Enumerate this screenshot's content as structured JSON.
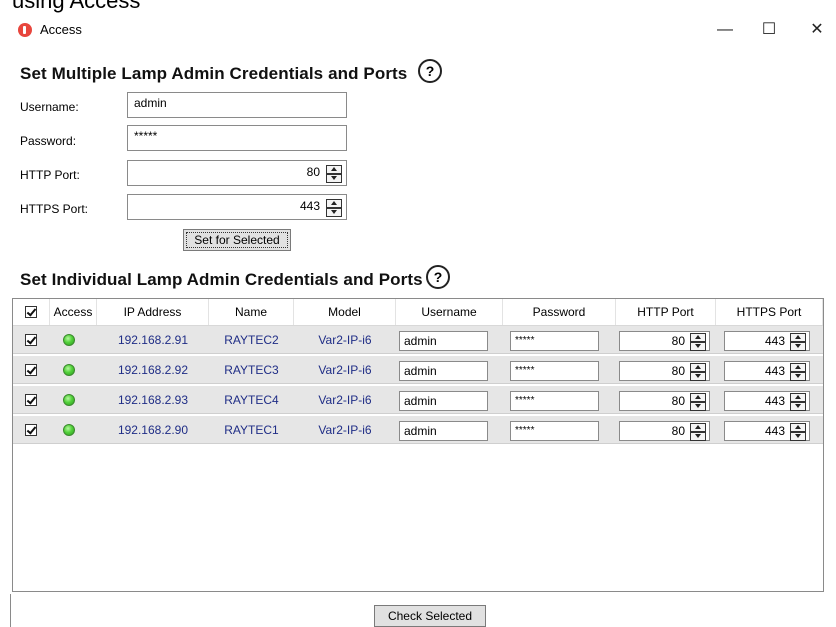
{
  "top_fragment": "using Access",
  "window": {
    "title": "Access",
    "controls": {
      "minimize": "—",
      "maximize": "☐",
      "close": "✕"
    }
  },
  "multiple": {
    "heading": "Set Multiple Lamp Admin Credentials and Ports",
    "help": "?",
    "username_label": "Username:",
    "username_value": "admin",
    "password_label": "Password:",
    "password_value": "*****",
    "http_label": "HTTP Port:",
    "http_value": "80",
    "https_label": "HTTPS Port:",
    "https_value": "443",
    "set_button": "Set for Selected"
  },
  "individual": {
    "heading": "Set Individual Lamp Admin Credentials and Ports",
    "help": "?",
    "columns": [
      "Access",
      "IP Address",
      "Name",
      "Model",
      "Username",
      "Password",
      "HTTP Port",
      "HTTPS Port"
    ],
    "header_checked": true,
    "rows": [
      {
        "checked": true,
        "access": "green",
        "ip": "192.168.2.91",
        "name": "RAYTEC2",
        "model": "Var2-IP-i6",
        "username": "admin",
        "password": "*****",
        "http": "80",
        "https": "443"
      },
      {
        "checked": true,
        "access": "green",
        "ip": "192.168.2.92",
        "name": "RAYTEC3",
        "model": "Var2-IP-i6",
        "username": "admin",
        "password": "*****",
        "http": "80",
        "https": "443"
      },
      {
        "checked": true,
        "access": "green",
        "ip": "192.168.2.93",
        "name": "RAYTEC4",
        "model": "Var2-IP-i6",
        "username": "admin",
        "password": "*****",
        "http": "80",
        "https": "443"
      },
      {
        "checked": true,
        "access": "green",
        "ip": "192.168.2.90",
        "name": "RAYTEC1",
        "model": "Var2-IP-i6",
        "username": "admin",
        "password": "*****",
        "http": "80",
        "https": "443"
      }
    ]
  },
  "footer": {
    "check_button": "Check Selected"
  },
  "colors": {
    "link": "#1f2d86",
    "row_bg": "#e6e6e6",
    "led": "#52d13a",
    "app_icon": "#e8463d"
  }
}
